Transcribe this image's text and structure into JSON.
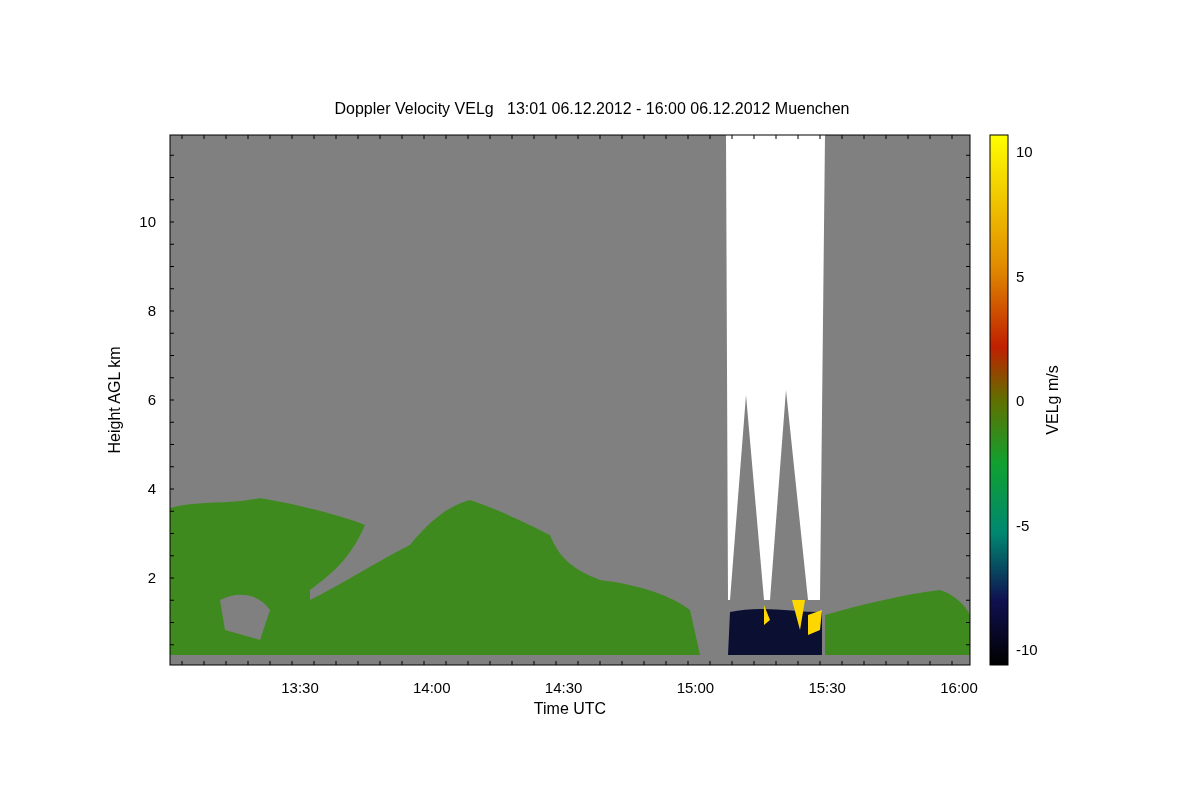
{
  "plot": {
    "title": "Doppler Velocity VELg   13:01 06.12.2012 - 16:00 06.12.2012 Muenchen",
    "xlabel": "Time UTC",
    "ylabel": "Height AGL km",
    "xticks": [
      "13:30",
      "14:00",
      "14:30",
      "15:00",
      "15:30",
      "16:00"
    ],
    "yticks": [
      "10",
      "8",
      "6",
      "4",
      "2"
    ]
  },
  "colorbar": {
    "label": "VELg m/s",
    "ticks": [
      "10",
      "5",
      "0",
      "-5",
      "-10"
    ]
  }
}
